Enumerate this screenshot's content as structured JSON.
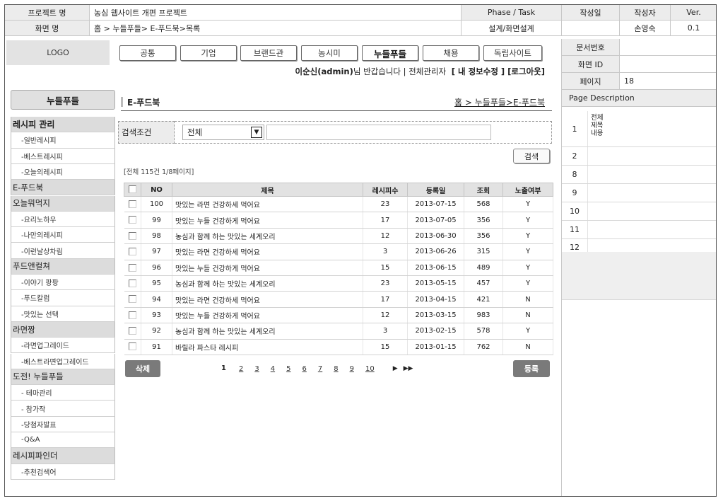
{
  "header": {
    "project_label": "프로젝트 명",
    "project_value": "농심 웹사이트 개편 프로젝트",
    "phase_label": "Phase / Task",
    "phase_value": "설계/화면설계",
    "screen_label": "화면 명",
    "screen_value": "홈 > 누들푸들> E-푸드북>목록",
    "date_label": "작성일",
    "author_label": "작성자",
    "author_value": "손영숙",
    "ver_label": "Ver.",
    "ver_value": "0.1"
  },
  "meta": {
    "doc_no_label": "문서번호",
    "screen_id_label": "화면 ID",
    "page_label": "페이지",
    "page_value": "18",
    "desc_label": "Page Description"
  },
  "logo": "LOGO",
  "nav_tabs": [
    "공통",
    "기업",
    "브랜드관",
    "농시미",
    "누들푸들",
    "채용",
    "독립사이트"
  ],
  "user_bar": {
    "user": "이순신(admin)",
    "greeting": "님 반갑습니다 | 전체관리자",
    "actions": "[ 내 정보수정 ] [로그아웃]"
  },
  "sidebar": {
    "title": "누들푸들",
    "items": [
      {
        "label": "레시피 관리",
        "type": "cat"
      },
      {
        "label": "-일반레시피",
        "type": "sub"
      },
      {
        "label": "-베스트레시피",
        "type": "sub"
      },
      {
        "label": "-오늘의레시피",
        "type": "sub"
      },
      {
        "label": "E-푸드북",
        "type": "cat"
      },
      {
        "label": "오늘뭐먹지",
        "type": "cat"
      },
      {
        "label": "-요리노하우",
        "type": "sub"
      },
      {
        "label": "-나만의레시피",
        "type": "sub"
      },
      {
        "label": "-이런날상차림",
        "type": "sub"
      },
      {
        "label": "푸드앤컬쳐",
        "type": "cat"
      },
      {
        "label": "-이야기 팡팡",
        "type": "sub"
      },
      {
        "label": "-푸드칼럼",
        "type": "sub"
      },
      {
        "label": "-맛있는 선택",
        "type": "sub"
      },
      {
        "label": "라면짱",
        "type": "cat"
      },
      {
        "label": "-라면업그레이드",
        "type": "sub"
      },
      {
        "label": "-베스트라면업그레이드",
        "type": "sub"
      },
      {
        "label": "도전! 누들푸들",
        "type": "cat"
      },
      {
        "label": "- 테마관리",
        "type": "sub"
      },
      {
        "label": "- 참가작",
        "type": "sub"
      },
      {
        "label": "-당첨자발표",
        "type": "sub"
      },
      {
        "label": "-Q&A",
        "type": "sub"
      },
      {
        "label": "레시피파인더",
        "type": "cat"
      },
      {
        "label": "-추천검색어",
        "type": "sub"
      }
    ]
  },
  "content": {
    "title": "E-푸드북",
    "breadcrumb": "홈 > 누들푸들>E-푸드북",
    "search_label": "검색조건",
    "search_select": "전체",
    "search_input": "",
    "search_button": "검색",
    "count_text": "[전체 115건  1/8페이지]",
    "delete_button": "삭제",
    "register_button": "등록"
  },
  "table": {
    "headers": [
      "NO",
      "제목",
      "레시피수",
      "등록일",
      "조회",
      "노출여부"
    ],
    "rows": [
      [
        "100",
        "맛있는 라면 건강하세 먹어요",
        "23",
        "2013-07-15",
        "568",
        "Y"
      ],
      [
        "99",
        "맛있는 누들 건강하게 먹어요",
        "17",
        "2013-07-05",
        "356",
        "Y"
      ],
      [
        "98",
        "농심과 함께 하는 맛있는 세계오리",
        "12",
        "2013-06-30",
        "356",
        "Y"
      ],
      [
        "97",
        "맛있는 라면 건강하세 먹어요",
        "3",
        "2013-06-26",
        "315",
        "Y"
      ],
      [
        "96",
        "맛있는 누들 건강하게 먹어요",
        "15",
        "2013-06-15",
        "489",
        "Y"
      ],
      [
        "95",
        "농심과 함께 하는 맛있는 세계오리",
        "23",
        "2013-05-15",
        "457",
        "Y"
      ],
      [
        "94",
        "맛있는 라면 건강하세 먹어요",
        "17",
        "2013-04-15",
        "421",
        "N"
      ],
      [
        "93",
        "맛있는 누들 건강하게 먹어요",
        "12",
        "2013-03-15",
        "983",
        "N"
      ],
      [
        "92",
        "농심과 함께 하는 맛있는 세계오리",
        "3",
        "2013-02-15",
        "578",
        "Y"
      ],
      [
        "91",
        "바릴라 파스타 레시피",
        "15",
        "2013-01-15",
        "762",
        "N"
      ]
    ]
  },
  "pagination": {
    "current": "1",
    "pages": [
      "2",
      "3",
      "4",
      "5",
      "6",
      "7",
      "8",
      "9",
      "10"
    ],
    "next_icon": "▶",
    "last_icon": "▶▶"
  },
  "description": {
    "rows": [
      {
        "num": "1",
        "text": "전체\n제목\n내용"
      },
      {
        "num": "2",
        "text": ""
      },
      {
        "num": "8",
        "text": ""
      },
      {
        "num": "9",
        "text": ""
      },
      {
        "num": "10",
        "text": ""
      },
      {
        "num": "11",
        "text": ""
      },
      {
        "num": "12",
        "text": ""
      }
    ]
  }
}
